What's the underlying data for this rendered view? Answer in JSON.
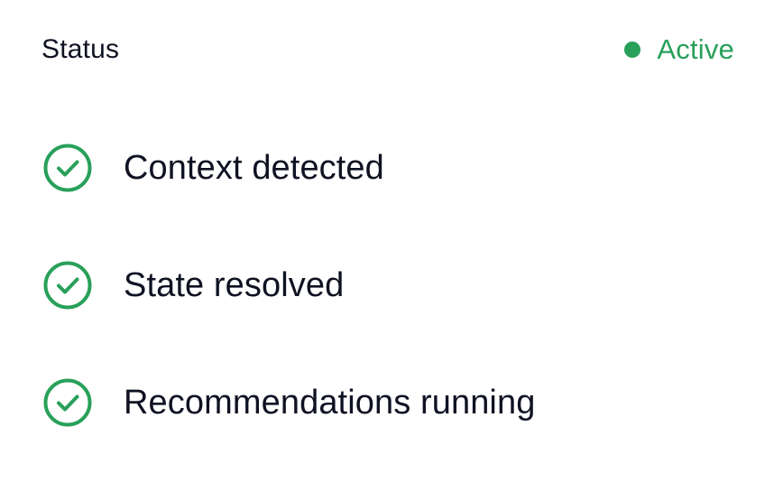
{
  "header": {
    "title": "Status",
    "status": {
      "label": "Active",
      "color": "#28a05a"
    }
  },
  "items": [
    {
      "label": "Context detected",
      "icon": "check-circle-icon",
      "state": "done"
    },
    {
      "label": "State resolved",
      "icon": "check-circle-icon",
      "state": "done"
    },
    {
      "label": "Recommendations running",
      "icon": "check-circle-icon",
      "state": "done"
    }
  ]
}
